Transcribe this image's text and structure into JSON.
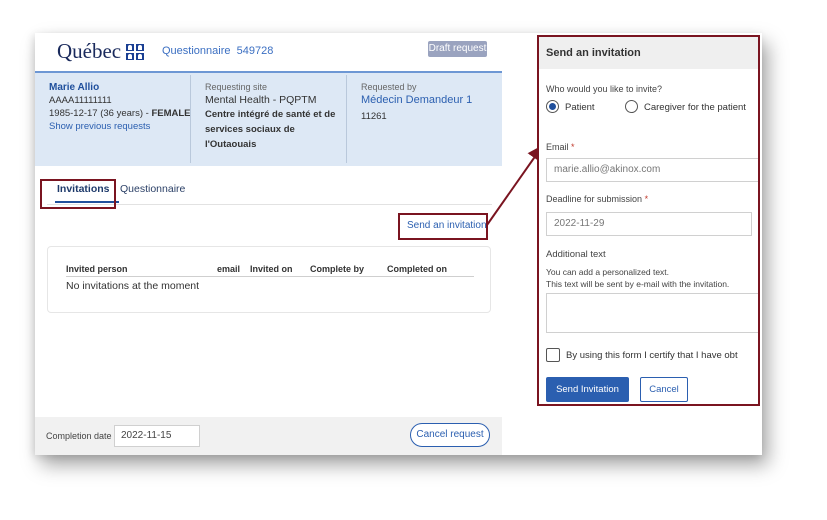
{
  "header": {
    "logo_text": "Québec",
    "questionnaire_label": "Questionnaire",
    "questionnaire_id": "549728",
    "draft_badge": "Draft request"
  },
  "patient": {
    "name": "Marie Allio",
    "id": "AAAA11111111",
    "dob_age": "1985-12-17 (36 years) -",
    "sex": "FEMALE",
    "show_previous": "Show previous requests"
  },
  "requesting_site": {
    "label": "Requesting site",
    "department": "Mental Health - PQPTM",
    "institution": "Centre intégré de santé et de services sociaux de l'Outaouais"
  },
  "requested_by": {
    "label": "Requested by",
    "name": "Médecin Demandeur 1",
    "number": "11261"
  },
  "tabs": [
    {
      "label": "Invitations",
      "active": true
    },
    {
      "label": "Questionnaire",
      "active": false
    }
  ],
  "send_invitation_link": "Send an invitation",
  "invitations_table": {
    "columns": [
      "Invited person",
      "email",
      "Invited on",
      "Complete by",
      "Completed on"
    ],
    "empty_message": "No invitations at the moment"
  },
  "footer": {
    "completion_label": "Completion date",
    "completion_value": "2022-11-15",
    "cancel_request": "Cancel request"
  },
  "panel": {
    "title": "Send an invitation",
    "who_question": "Who would you like to invite?",
    "options": [
      {
        "label": "Patient",
        "selected": true
      },
      {
        "label": "Caregiver for the patient",
        "selected": false
      }
    ],
    "email_label": "Email",
    "email_value": "marie.allio@akinox.com",
    "deadline_label": "Deadline for submission",
    "deadline_value": "2022-11-29",
    "additional_label": "Additional text",
    "additional_hint_1": "You can add a personalized text.",
    "additional_hint_2": "This text will be sent by e-mail with the invitation.",
    "certify_label": "By using this form I certify that I have obt",
    "required_mark": "*",
    "send_button": "Send Invitation",
    "cancel_button": "Cancel"
  },
  "colors": {
    "accent": "#2b5fb0",
    "highlight_border": "#7a1420",
    "patient_band": "#dde8f5"
  }
}
